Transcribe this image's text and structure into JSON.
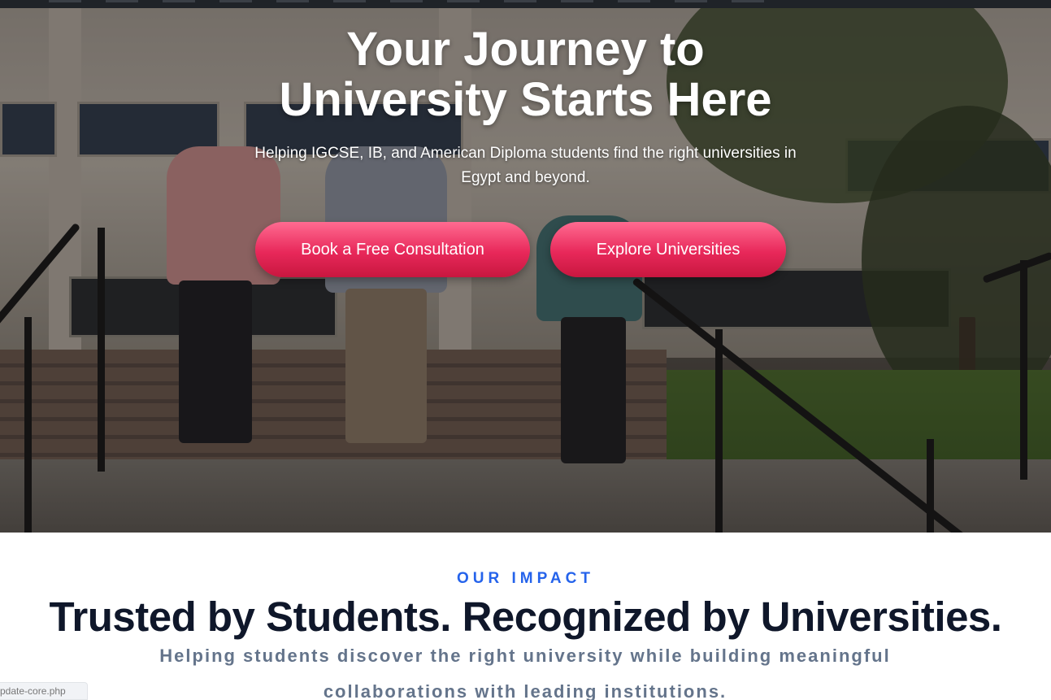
{
  "hero": {
    "title": "Your Journey to University Starts Here",
    "subtitle": "Helping IGCSE, IB, and American Diploma students find the right universities in Egypt and beyond.",
    "buttons": {
      "consult_label": "Book a Free Consultation",
      "explore_label": "Explore Universities"
    }
  },
  "impact": {
    "eyebrow": "OUR IMPACT",
    "title": "Trusted by Students. Recognized by Universities.",
    "subtitle": "Helping students discover the right university while building meaningful collaborations with leading institutions."
  },
  "status_tip": "pdate-core.php",
  "colors": {
    "button_gradient": [
      "#ff6b91",
      "#e8285a"
    ],
    "eyebrow": "#2563eb",
    "title": "#0f172a",
    "subtitle": "#64748b"
  }
}
